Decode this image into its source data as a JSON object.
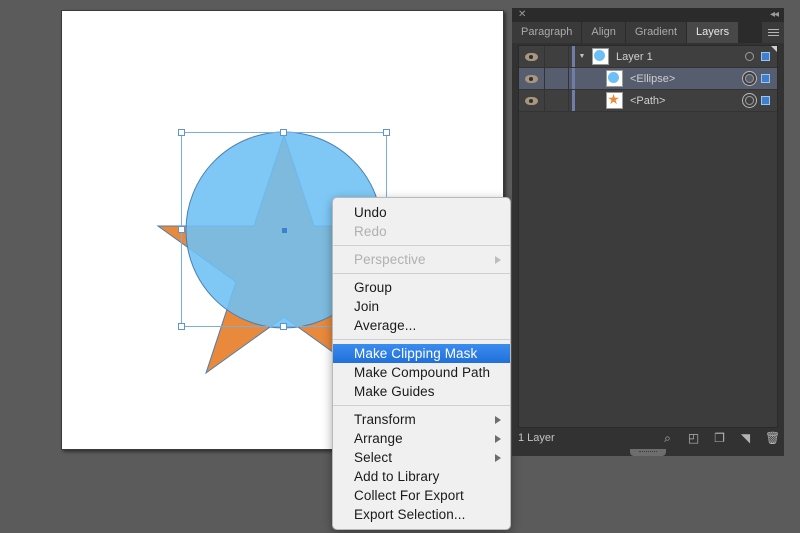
{
  "app": {
    "background_color": "#5b5b5b",
    "canvas_color": "#ffffff"
  },
  "artwork": {
    "ellipse_color": "#6dc0f5",
    "star_color": "#e8893c",
    "stroke_color": "#4a7fb5",
    "selection_color": "#7aaede"
  },
  "context_menu": {
    "items": [
      {
        "label": "Undo",
        "state": "enabled",
        "submenu": false,
        "separator_after": false
      },
      {
        "label": "Redo",
        "state": "disabled",
        "submenu": false,
        "separator_after": true
      },
      {
        "label": "Perspective",
        "state": "disabled",
        "submenu": true,
        "separator_after": true
      },
      {
        "label": "Group",
        "state": "enabled",
        "submenu": false,
        "separator_after": false
      },
      {
        "label": "Join",
        "state": "enabled",
        "submenu": false,
        "separator_after": false
      },
      {
        "label": "Average...",
        "state": "enabled",
        "submenu": false,
        "separator_after": true
      },
      {
        "label": "Make Clipping Mask",
        "state": "selected",
        "submenu": false,
        "separator_after": false
      },
      {
        "label": "Make Compound Path",
        "state": "enabled",
        "submenu": false,
        "separator_after": false
      },
      {
        "label": "Make Guides",
        "state": "enabled",
        "submenu": false,
        "separator_after": true
      },
      {
        "label": "Transform",
        "state": "enabled",
        "submenu": true,
        "separator_after": false
      },
      {
        "label": "Arrange",
        "state": "enabled",
        "submenu": true,
        "separator_after": false
      },
      {
        "label": "Select",
        "state": "enabled",
        "submenu": true,
        "separator_after": false
      },
      {
        "label": "Add to Library",
        "state": "enabled",
        "submenu": false,
        "separator_after": false
      },
      {
        "label": "Collect For Export",
        "state": "enabled",
        "submenu": false,
        "separator_after": false
      },
      {
        "label": "Export Selection...",
        "state": "enabled",
        "submenu": false,
        "separator_after": false
      }
    ],
    "highlight_color": "#2170da"
  },
  "panel": {
    "close_glyph": "✕",
    "collapse_glyph": "◂◂",
    "tabs": [
      {
        "label": "Paragraph",
        "active": false
      },
      {
        "label": "Align",
        "active": false
      },
      {
        "label": "Gradient",
        "active": false
      },
      {
        "label": "Layers",
        "active": true
      }
    ],
    "layers": [
      {
        "name": "Layer 1",
        "kind": "layer",
        "visible": true,
        "locked": false,
        "selected": false,
        "expanded": true,
        "disclosure_glyph": "▼",
        "thumb": "circle",
        "targeted": false
      },
      {
        "name": "<Ellipse>",
        "kind": "object",
        "visible": true,
        "locked": false,
        "selected": true,
        "expanded": false,
        "disclosure_glyph": "",
        "thumb": "circle",
        "targeted": true
      },
      {
        "name": "<Path>",
        "kind": "object",
        "visible": true,
        "locked": false,
        "selected": false,
        "expanded": false,
        "disclosure_glyph": "",
        "thumb": "star",
        "targeted": true
      }
    ],
    "footer": {
      "layer_count": "1 Layer",
      "icons": [
        {
          "name": "locate-object-icon",
          "glyph": "⌕"
        },
        {
          "name": "make-clipping-mask-icon",
          "glyph": "◰"
        },
        {
          "name": "create-new-sublayer-icon",
          "glyph": "❐"
        },
        {
          "name": "create-new-layer-icon",
          "glyph": "◥"
        },
        {
          "name": "delete-selection-icon",
          "glyph": "🗑"
        }
      ]
    }
  }
}
